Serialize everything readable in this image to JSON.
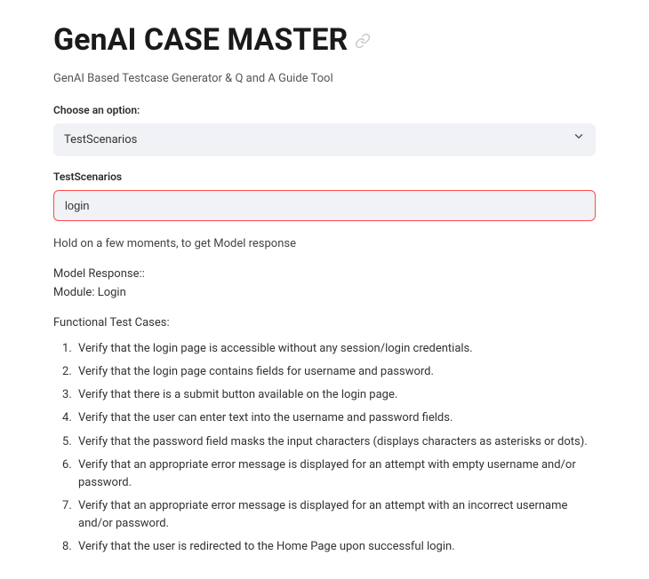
{
  "header": {
    "title": "GenAI CASE MASTER",
    "subtitle": "GenAI Based Testcase Generator & Q and A Guide Tool"
  },
  "options": {
    "label": "Choose an option:",
    "selected": "TestScenarios"
  },
  "scenario_input": {
    "label": "TestScenarios",
    "value": "login"
  },
  "status": "Hold on a few moments, to get Model response",
  "response": {
    "header": "Model Response::",
    "module": "Module: Login",
    "section_title": "Functional Test Cases:",
    "cases": [
      "Verify that the login page is accessible without any session/login credentials.",
      "Verify that the login page contains fields for username and password.",
      "Verify that there is a submit button available on the login page.",
      "Verify that the user can enter text into the username and password fields.",
      "Verify that the password field masks the input characters (displays characters as asterisks or dots).",
      "Verify that an appropriate error message is displayed for an attempt with empty username and/or password.",
      "Verify that an appropriate error message is displayed for an attempt with an incorrect username and/or password.",
      "Verify that the user is redirected to the Home Page upon successful login."
    ]
  }
}
